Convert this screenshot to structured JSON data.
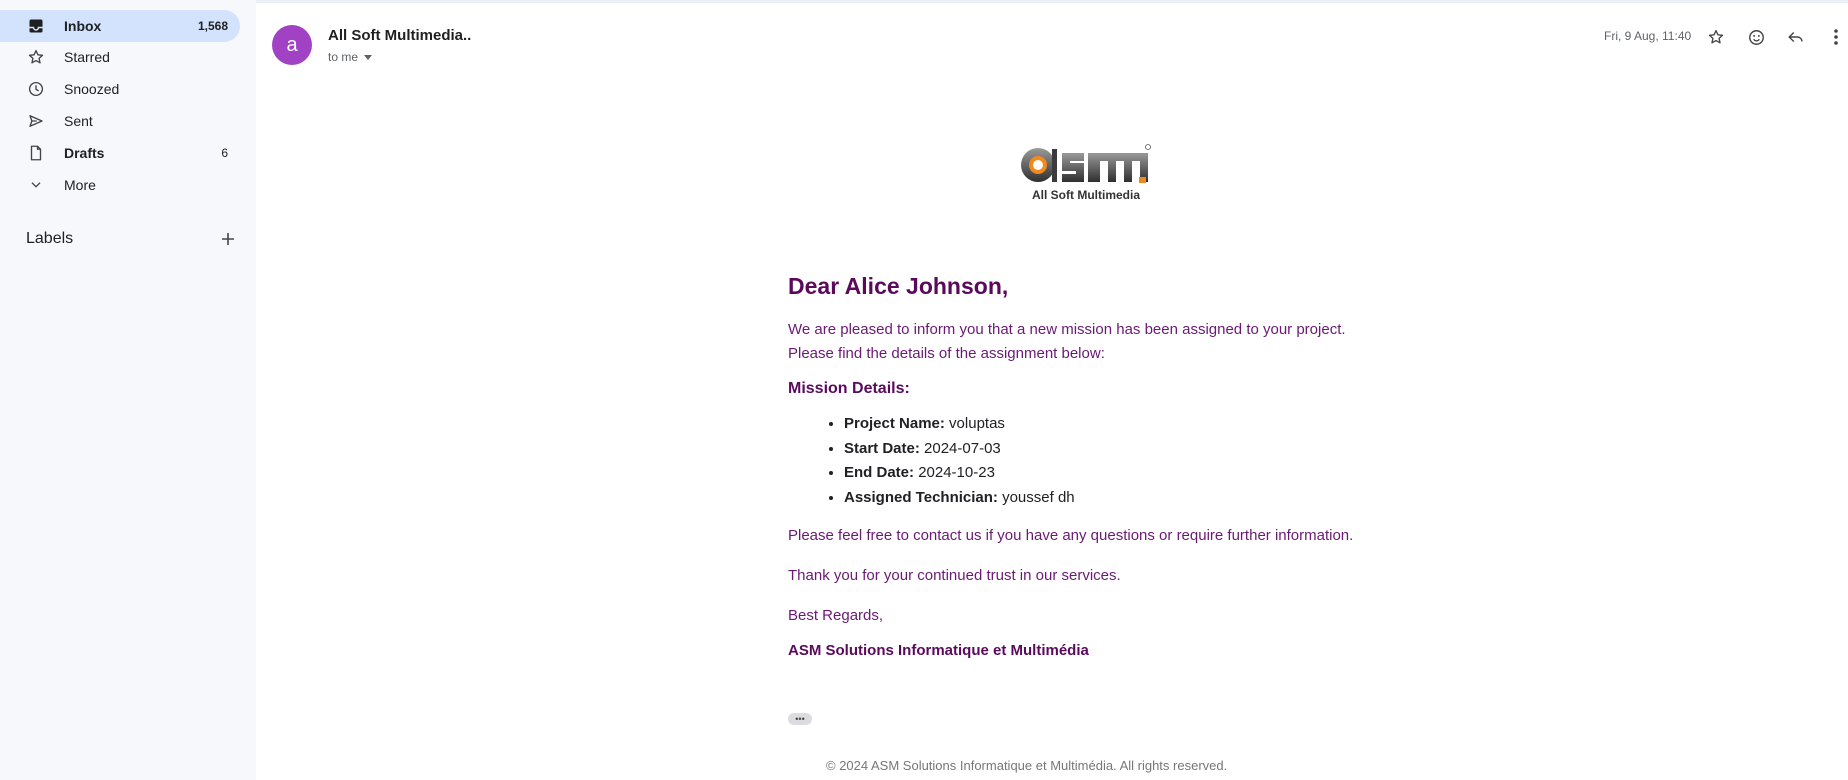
{
  "sidebar": {
    "items": [
      {
        "label": "Inbox",
        "count": "1,568",
        "icon": "inbox-icon"
      },
      {
        "label": "Starred",
        "count": "",
        "icon": "star-icon"
      },
      {
        "label": "Snoozed",
        "count": "",
        "icon": "clock-icon"
      },
      {
        "label": "Sent",
        "count": "",
        "icon": "send-icon"
      },
      {
        "label": "Drafts",
        "count": "6",
        "icon": "file-icon"
      },
      {
        "label": "More",
        "count": "",
        "icon": "chevron-down-icon"
      }
    ],
    "labels_title": "Labels"
  },
  "header": {
    "avatar_letter": "a",
    "sender": "All Soft Multimedia..",
    "to": "to me",
    "date": "Fri, 9 Aug, 11:40"
  },
  "email": {
    "logo_text": "asm",
    "logo_subtitle": "All Soft Multimedia",
    "greeting": "Dear Alice Johnson,",
    "intro_line1": "We are pleased to inform you that a new mission has been assigned to your project.",
    "intro_line2": "Please find the details of the assignment below:",
    "details_title": "Mission Details:",
    "details": [
      {
        "label": "Project Name:",
        "value": "voluptas"
      },
      {
        "label": "Start Date:",
        "value": "2024-07-03"
      },
      {
        "label": "End Date:",
        "value": "2024-10-23"
      },
      {
        "label": "Assigned Technician:",
        "value": "youssef dh"
      }
    ],
    "contact": "Please feel free to contact us if you have any questions or require further information.",
    "thanks": "Thank you for your continued trust in our services.",
    "closing": "Best Regards,",
    "signature": "ASM Solutions Informatique et Multimédia",
    "footer": "© 2024 ASM Solutions Informatique et Multimédia. All rights reserved."
  },
  "colors": {
    "accent": "#d3e3fd",
    "avatar": "#a142c4",
    "email_text": "#5b0a5b"
  }
}
